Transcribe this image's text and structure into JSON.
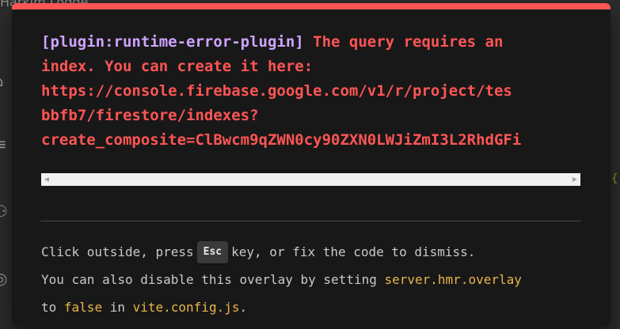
{
  "background": {
    "title": "Harkim Lodge",
    "right_mark": "{"
  },
  "overlay": {
    "plugin_tag": "[plugin:runtime-error-plugin]",
    "message_lines": [
      " The query requires an",
      "index. You can create it here:",
      "https://console.firebase.google.com/v1/r/project/tes",
      "bbfb7/firestore/indexes?",
      "create_composite=ClBwcm9qZWN0cy90ZXN0LWJiZmI3L2RhdGFi"
    ],
    "scrollbar": {
      "left_arrow": "◀",
      "right_arrow": "▶"
    },
    "tip": {
      "line1_pre": "Click outside, press",
      "line1_key": "Esc",
      "line1_post": "key, or fix the code to dismiss.",
      "line2_pre": "You can also disable this overlay by setting ",
      "line2_code": "server.hmr.overlay",
      "line3_pre": "to ",
      "line3_code1": "false",
      "line3_mid": " in ",
      "line3_code2": "vite.config.js",
      "line3_post": "."
    }
  },
  "colors": {
    "accent_red": "#ff5555",
    "plugin_purple": "#cfa4ff",
    "code_yellow": "#e8b54a",
    "panel_bg": "#181818"
  }
}
